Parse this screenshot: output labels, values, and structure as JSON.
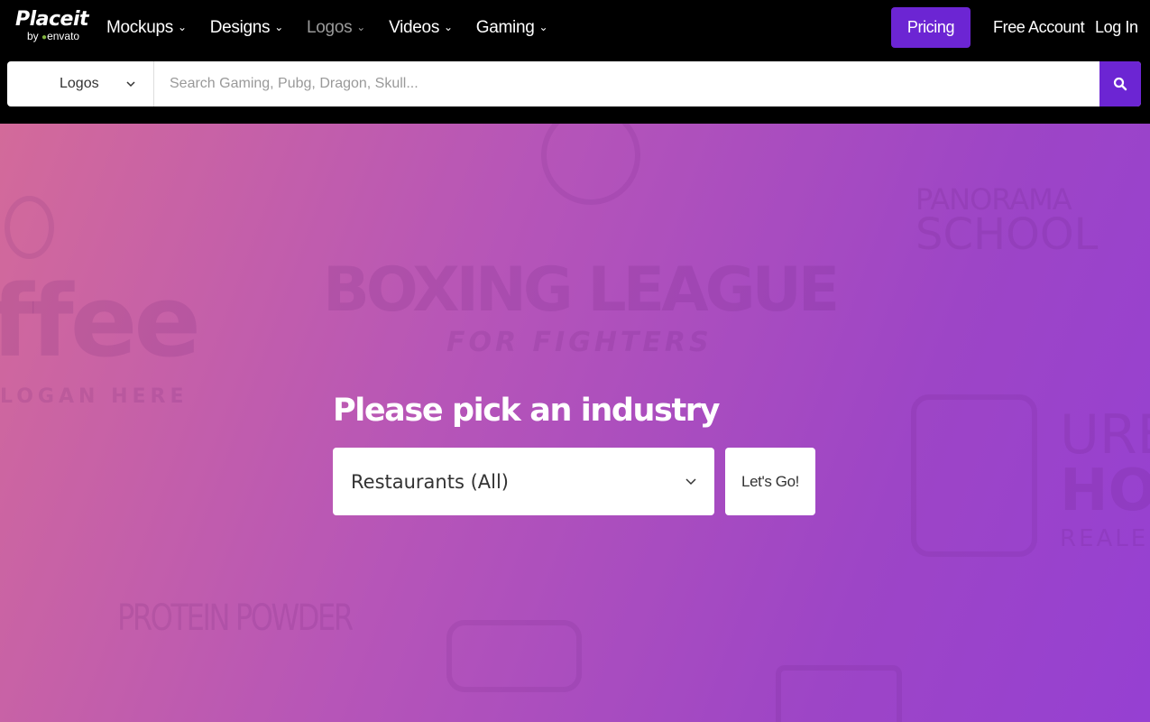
{
  "brand": {
    "name": "Placeit",
    "by": "by",
    "sub": "envato"
  },
  "nav": {
    "items": [
      {
        "label": "Mockups",
        "active": false
      },
      {
        "label": "Designs",
        "active": false
      },
      {
        "label": "Logos",
        "active": true
      },
      {
        "label": "Videos",
        "active": false
      },
      {
        "label": "Gaming",
        "active": false
      }
    ],
    "pricing": "Pricing",
    "free_account": "Free Account",
    "login": "Log In"
  },
  "search": {
    "category": "Logos",
    "placeholder": "Search Gaming, Pubg, Dragon, Skull...",
    "value": ""
  },
  "background_art": {
    "texts": [
      "BOXING LEAGUE",
      "FOR FIGHTERS",
      "ffee",
      "LOGAN HERE",
      "PANORAMA",
      "SCHOOL",
      "URB",
      "HO",
      "REALE",
      "PROTEIN POWDER"
    ]
  },
  "hero": {
    "title": "Please pick an industry",
    "industry_selected": "Restaurants (All)",
    "cta": "Let's Go!"
  },
  "colors": {
    "accent": "#6c25d3",
    "gradient_start": "#d36a9a",
    "gradient_end": "#9640d2"
  },
  "icons": {
    "nav_caret": "chevron-down-icon",
    "search": "search-icon",
    "dropdown": "chevron-down-icon"
  }
}
